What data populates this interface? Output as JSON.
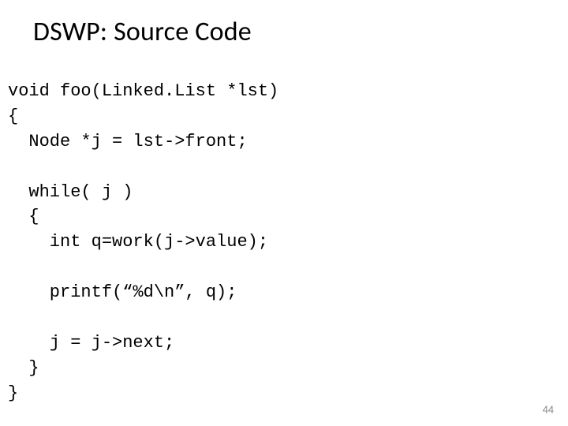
{
  "slide": {
    "title": "DSWP: Source Code",
    "page_number": "44"
  },
  "code": {
    "l01": "void foo(Linked.List *lst)",
    "l02": "{",
    "l03": "  Node *j = lst->front;",
    "l04": "",
    "l05": "  while( j )",
    "l06": "  {",
    "l07": "    int q=work(j->value);",
    "l08": "",
    "l09": "    printf(“%d\\n”, q);",
    "l10": "",
    "l11": "    j = j->next;",
    "l12": "  }",
    "l13": "}"
  }
}
